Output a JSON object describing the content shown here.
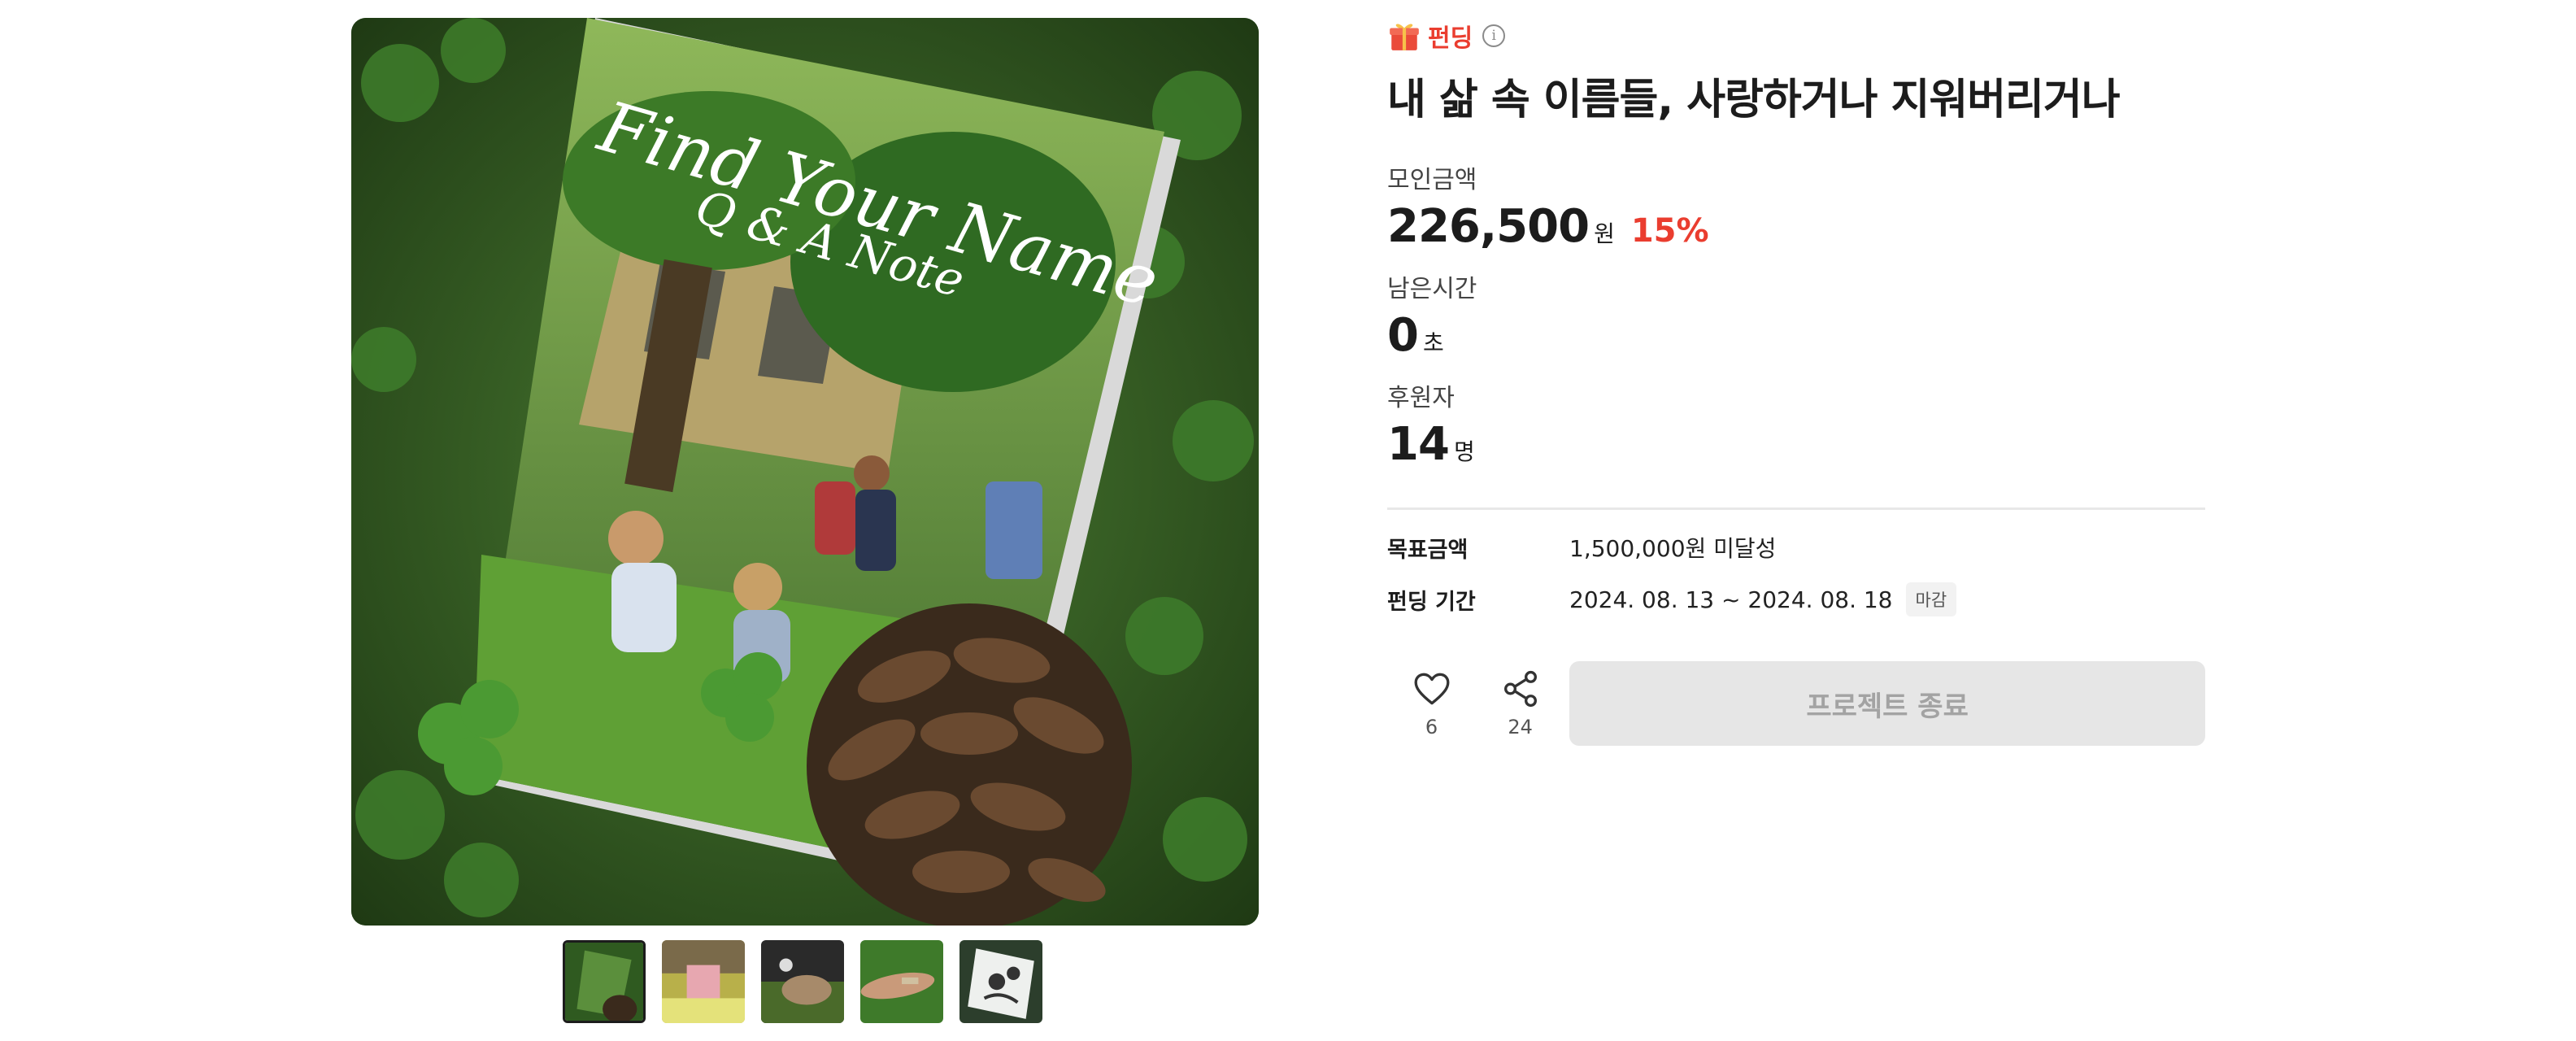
{
  "category": {
    "label": "펀딩",
    "icon": "gift-icon",
    "info_icon": "info-icon",
    "accent_color": "#ea3d2f"
  },
  "project": {
    "title": "내 삶 속 이름들, 사랑하거나 지워버리거나"
  },
  "media": {
    "main_image": {
      "cover_title": "Find Your Name",
      "cover_subtitle": "Q & A Note"
    },
    "thumbnail_count": 5,
    "active_thumbnail": 1
  },
  "stats": {
    "raised": {
      "label": "모인금액",
      "value": "226,500",
      "unit": "원",
      "rate": "15%"
    },
    "remaining": {
      "label": "남은시간",
      "value": "0",
      "unit": "초"
    },
    "backers": {
      "label": "후원자",
      "value": "14",
      "unit": "명"
    }
  },
  "meta": {
    "goal": {
      "label": "목표금액",
      "value": "1,500,000원 미달성"
    },
    "period": {
      "label": "펀딩 기간",
      "value": "2024. 08. 13 ~ 2024. 08. 18",
      "badge": "마감"
    }
  },
  "actions": {
    "like": {
      "icon": "heart-icon",
      "count": "6"
    },
    "share": {
      "icon": "share-icon",
      "count": "24"
    },
    "end_button_label": "프로젝트 종료"
  }
}
